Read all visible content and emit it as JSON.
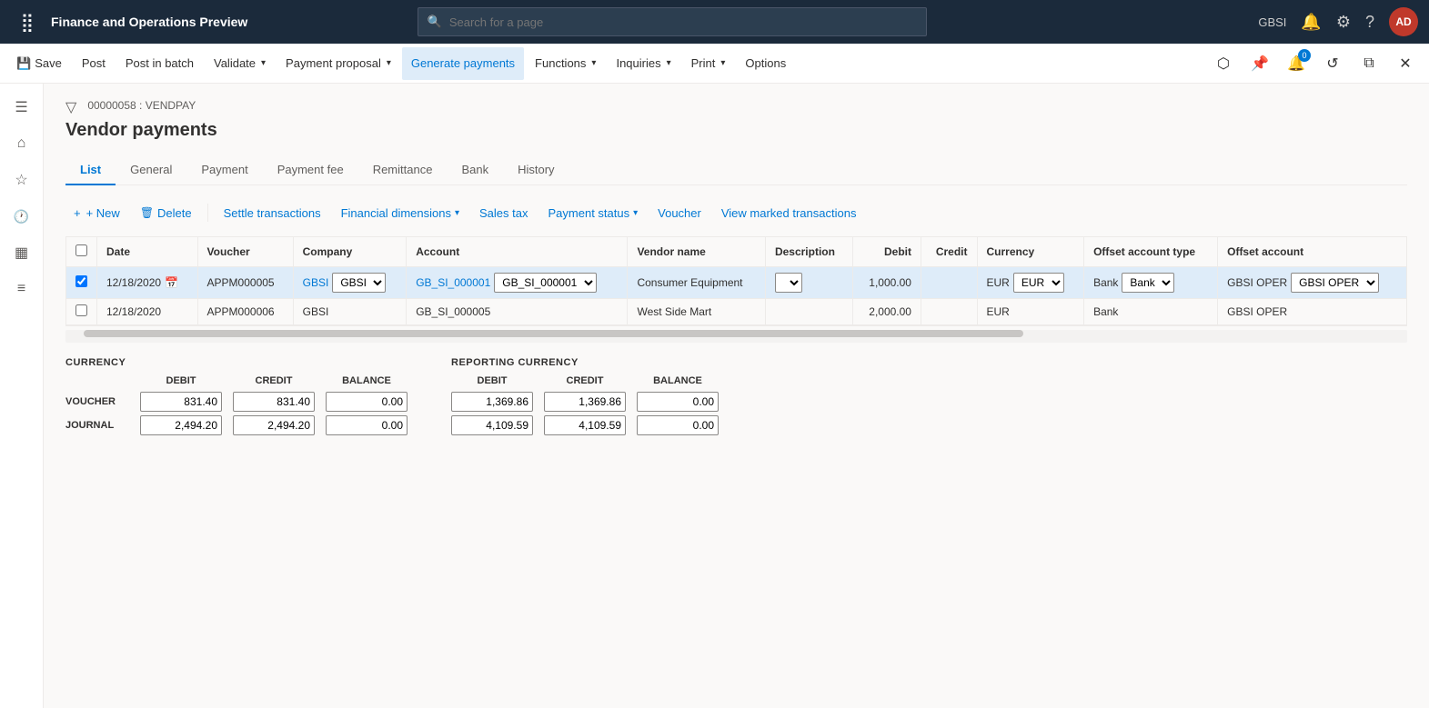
{
  "topNav": {
    "appTitle": "Finance and Operations Preview",
    "searchPlaceholder": "Search for a page",
    "userInitials": "AD",
    "userBg": "#c0392b"
  },
  "commandBar": {
    "buttons": [
      {
        "id": "save",
        "label": "Save",
        "icon": "💾"
      },
      {
        "id": "post",
        "label": "Post",
        "icon": ""
      },
      {
        "id": "postInBatch",
        "label": "Post in batch",
        "icon": ""
      },
      {
        "id": "validate",
        "label": "Validate",
        "icon": "",
        "hasDropdown": true
      },
      {
        "id": "paymentProposal",
        "label": "Payment proposal",
        "icon": "",
        "hasDropdown": true
      },
      {
        "id": "generatePayments",
        "label": "Generate payments",
        "icon": "",
        "highlighted": true
      },
      {
        "id": "functions",
        "label": "Functions",
        "icon": "",
        "hasDropdown": true
      },
      {
        "id": "inquiries",
        "label": "Inquiries",
        "icon": "",
        "hasDropdown": true
      },
      {
        "id": "print",
        "label": "Print",
        "icon": "",
        "hasDropdown": true
      },
      {
        "id": "options",
        "label": "Options",
        "icon": ""
      }
    ],
    "rightIcons": [
      {
        "id": "personalize",
        "icon": "⬡"
      },
      {
        "id": "bookmark",
        "icon": "🔖"
      },
      {
        "id": "notifications",
        "icon": "🔔",
        "badge": "0"
      },
      {
        "id": "refresh",
        "icon": "↺"
      },
      {
        "id": "newWindow",
        "icon": "⧉"
      },
      {
        "id": "close",
        "icon": "✕"
      }
    ]
  },
  "sidebar": {
    "items": [
      {
        "id": "menu",
        "icon": "☰"
      },
      {
        "id": "home",
        "icon": "⌂"
      },
      {
        "id": "favorites",
        "icon": "★"
      },
      {
        "id": "recent",
        "icon": "🕐"
      },
      {
        "id": "workspaces",
        "icon": "▦"
      },
      {
        "id": "list",
        "icon": "≡"
      }
    ]
  },
  "page": {
    "breadcrumb": "00000058 : VENDPAY",
    "title": "Vendor payments"
  },
  "tabs": [
    {
      "id": "list",
      "label": "List",
      "active": true
    },
    {
      "id": "general",
      "label": "General"
    },
    {
      "id": "payment",
      "label": "Payment"
    },
    {
      "id": "paymentFee",
      "label": "Payment fee"
    },
    {
      "id": "remittance",
      "label": "Remittance"
    },
    {
      "id": "bank",
      "label": "Bank"
    },
    {
      "id": "history",
      "label": "History"
    }
  ],
  "toolbar": {
    "new": "+ New",
    "delete": "Delete",
    "settleTransactions": "Settle transactions",
    "financialDimensions": "Financial dimensions",
    "salesTax": "Sales tax",
    "paymentStatus": "Payment status",
    "voucher": "Voucher",
    "viewMarkedTransactions": "View marked transactions"
  },
  "table": {
    "columns": [
      {
        "id": "check",
        "label": ""
      },
      {
        "id": "date",
        "label": "Date"
      },
      {
        "id": "voucher",
        "label": "Voucher"
      },
      {
        "id": "company",
        "label": "Company"
      },
      {
        "id": "account",
        "label": "Account"
      },
      {
        "id": "vendorName",
        "label": "Vendor name"
      },
      {
        "id": "description",
        "label": "Description"
      },
      {
        "id": "debit",
        "label": "Debit"
      },
      {
        "id": "credit",
        "label": "Credit"
      },
      {
        "id": "currency",
        "label": "Currency"
      },
      {
        "id": "offsetAccountType",
        "label": "Offset account type"
      },
      {
        "id": "offsetAccount",
        "label": "Offset account"
      }
    ],
    "rows": [
      {
        "selected": true,
        "date": "12/18/2020",
        "voucher": "APPM000005",
        "company": "GBSI",
        "account": "GB_SI_000001",
        "vendorName": "Consumer Equipment",
        "description": "",
        "debit": "1,000.00",
        "credit": "",
        "currency": "EUR",
        "offsetAccountType": "Bank",
        "offsetAccount": "GBSI OPER"
      },
      {
        "selected": false,
        "date": "12/18/2020",
        "voucher": "APPM000006",
        "company": "GBSI",
        "account": "GB_SI_000005",
        "vendorName": "West Side Mart",
        "description": "",
        "debit": "2,000.00",
        "credit": "",
        "currency": "EUR",
        "offsetAccountType": "Bank",
        "offsetAccount": "GBSI OPER"
      }
    ]
  },
  "summary": {
    "currency": {
      "title": "CURRENCY",
      "headers": [
        "DEBIT",
        "CREDIT",
        "BALANCE"
      ],
      "rows": [
        {
          "label": "VOUCHER",
          "debit": "831.40",
          "credit": "831.40",
          "balance": "0.00"
        },
        {
          "label": "JOURNAL",
          "debit": "2,494.20",
          "credit": "2,494.20",
          "balance": "0.00"
        }
      ]
    },
    "reportingCurrency": {
      "title": "REPORTING CURRENCY",
      "headers": [
        "DEBIT",
        "CREDIT",
        "BALANCE"
      ],
      "rows": [
        {
          "label": "",
          "debit": "1,369.86",
          "credit": "1,369.86",
          "balance": "0.00"
        },
        {
          "label": "",
          "debit": "4,109.59",
          "credit": "4,109.59",
          "balance": "0.00"
        }
      ]
    }
  }
}
